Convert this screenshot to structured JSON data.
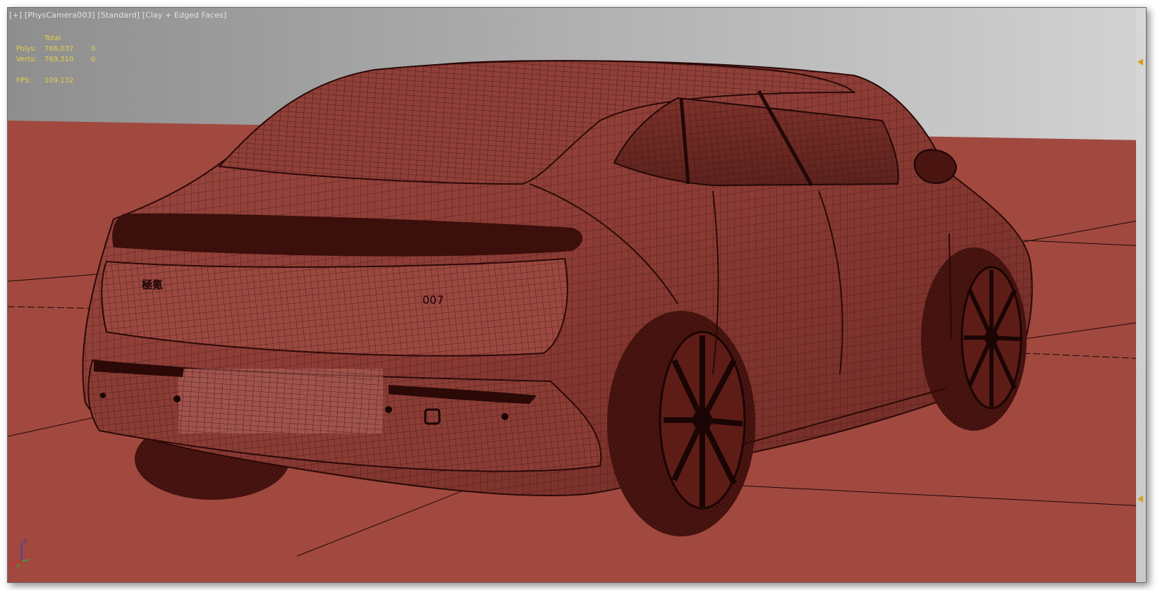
{
  "viewport": {
    "label_parts": [
      "[+]",
      "[PhysCamera003]",
      "[Standard]",
      "[Clay + Edged Faces]"
    ],
    "background_color": "#a1493f",
    "sky_color_left": "#8e8e8e",
    "sky_color_right": "#d2d2d2",
    "mesh_color": "#3a0d0a"
  },
  "stats": {
    "total_header": "Total",
    "polys_label": "Polys:",
    "polys_value": "766,037",
    "polys_selected": "0",
    "verts_label": "Verts:",
    "verts_value": "769,310",
    "verts_selected": "0",
    "fps_label": "FPS:",
    "fps_value": "109.132",
    "text_color": "#e5d04a"
  },
  "car": {
    "plate_text": "007",
    "badge_text": "極氪"
  },
  "axis": {
    "z_label": "z",
    "x_label": "x",
    "y_label": "y"
  }
}
